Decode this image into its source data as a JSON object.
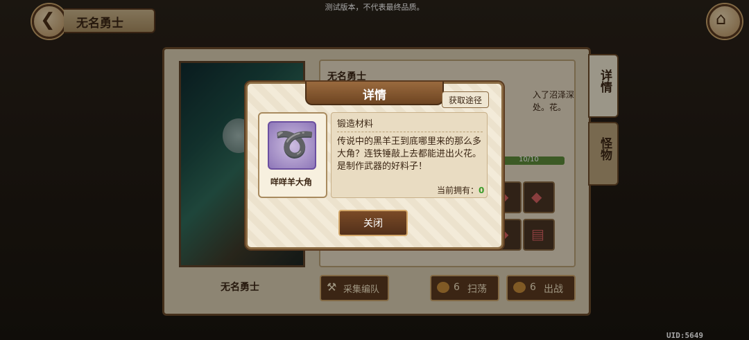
{
  "watermark": "测试版本，不代表最终品质。",
  "header": {
    "title": "无名勇士",
    "back_icon": "back-arrow-icon",
    "home_icon": "home-icon"
  },
  "uid": "UID:5649",
  "background": {
    "right_title": "无名勇士",
    "right_desc": "入了沼泽深处。花。",
    "progress": "10/10",
    "scene_name": "无名勇士",
    "tabs": {
      "detail": "详情",
      "monster": "怪物"
    },
    "buttons": {
      "collect": "采集编队",
      "sweep_cost": "6",
      "sweep": "扫荡",
      "fight_cost": "6",
      "fight": "出战"
    }
  },
  "modal": {
    "title": "详情",
    "get_way": "获取途径",
    "item_name": "咩咩羊大角",
    "item_type": "锻造材料",
    "item_desc": "传说中的黑羊王到底哪里来的那么多大角？连铁锤敲上去都能进出火花。是制作武器的好料子！",
    "owned_label": "当前拥有：",
    "owned_count": "0",
    "close": "关闭"
  }
}
